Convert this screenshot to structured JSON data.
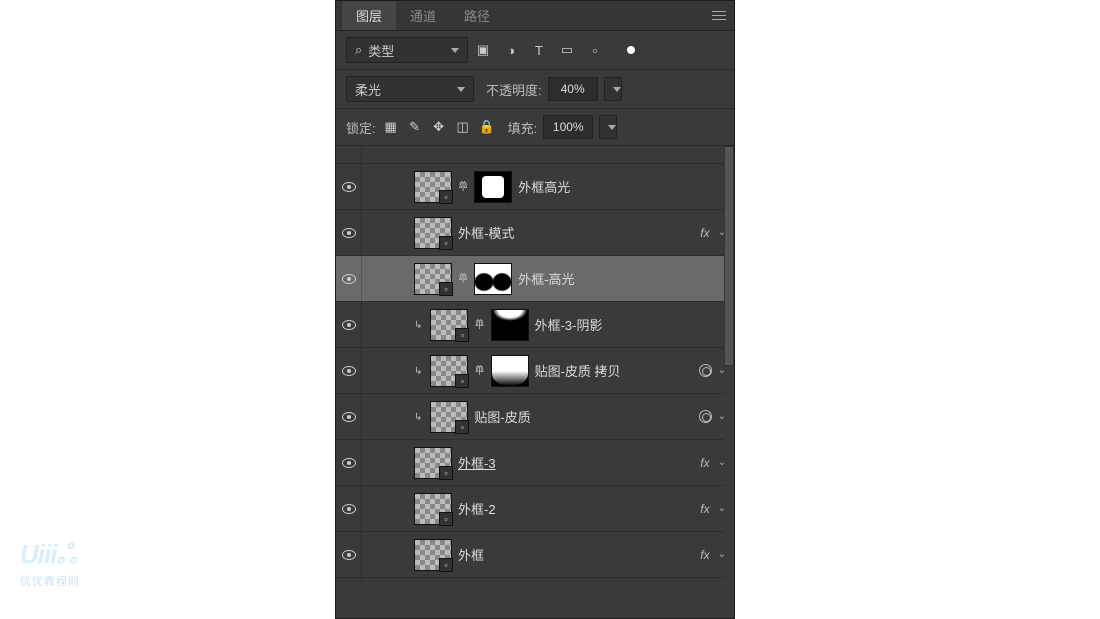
{
  "tabs": {
    "layers": "图层",
    "channels": "通道",
    "paths": "路径"
  },
  "filter": {
    "label": "类型",
    "search_glyph": "⌕"
  },
  "filter_icons": [
    "image-icon",
    "adjust-icon",
    "type-icon",
    "shape-icon",
    "smart-icon",
    "dot-icon"
  ],
  "blend": {
    "mode": "柔光",
    "opacity_label": "不透明度:",
    "opacity_value": "40%"
  },
  "lock": {
    "label": "锁定:",
    "fill_label": "填充:",
    "fill_value": "100%"
  },
  "lock_icons": [
    "lock-pixels-icon",
    "lock-brush-icon",
    "lock-move-icon",
    "lock-crop-icon",
    "lock-all-icon"
  ],
  "layers": [
    {
      "name": "外框高光",
      "indent": 40,
      "thumbCk": true,
      "link": true,
      "maskType": "rect",
      "fx": false,
      "circle": false,
      "clip": false,
      "selected": false
    },
    {
      "name": "外框-模式",
      "indent": 40,
      "thumbCk": true,
      "link": false,
      "maskType": null,
      "fx": true,
      "circle": false,
      "clip": false,
      "selected": false
    },
    {
      "name": "外框-高光",
      "indent": 40,
      "thumbCk": true,
      "link": true,
      "maskType": "sides",
      "fx": false,
      "circle": false,
      "clip": false,
      "selected": true
    },
    {
      "name": "外框-3-阴影",
      "indent": 40,
      "thumbCk": true,
      "link": true,
      "maskType": "top",
      "fx": false,
      "circle": false,
      "clip": true,
      "selected": false
    },
    {
      "name": "贴图-皮质 拷贝",
      "indent": 40,
      "thumbCk": true,
      "link": true,
      "maskType": "bottom",
      "fx": false,
      "circle": true,
      "clip": true,
      "selected": false
    },
    {
      "name": "贴图-皮质",
      "indent": 40,
      "thumbCk": true,
      "link": false,
      "maskType": null,
      "fx": false,
      "circle": true,
      "clip": true,
      "selected": false
    },
    {
      "name": "外框-3",
      "indent": 40,
      "thumbCk": true,
      "link": false,
      "maskType": null,
      "fx": true,
      "circle": false,
      "clip": false,
      "selected": false,
      "underline": true
    },
    {
      "name": "外框-2",
      "indent": 40,
      "thumbCk": true,
      "link": false,
      "maskType": null,
      "fx": true,
      "circle": false,
      "clip": false,
      "selected": false
    },
    {
      "name": "外框",
      "indent": 40,
      "thumbCk": true,
      "link": false,
      "maskType": null,
      "fx": true,
      "circle": false,
      "clip": false,
      "selected": false
    }
  ],
  "fx_text": "fx",
  "watermark": {
    "big": "Uiiiஃ",
    "small": "优优教程网"
  }
}
